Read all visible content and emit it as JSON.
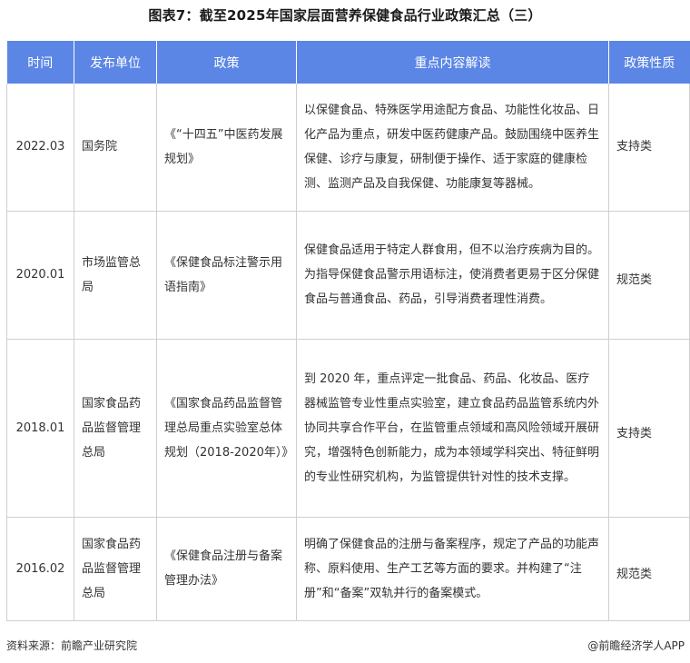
{
  "title": "图表7：截至2025年国家层面营养保健食品行业政策汇总（三）",
  "table": {
    "headers": [
      "时间",
      "发布单位",
      "政策",
      "重点内容解读",
      "政策性质"
    ],
    "rows": [
      {
        "time": "2022.03",
        "issuer": "国务院",
        "policy": "《“十四五”中医药发展规划》",
        "content": "以保健食品、特殊医学用途配方食品、功能性化妆品、日化产品为重点，研发中医药健康产品。鼓励围绕中医养生保健、诊疗与康复，研制便于操作、适于家庭的健康检测、监测产品及自我保健、功能康复等器械。",
        "nature": "支持类"
      },
      {
        "time": "2020.01",
        "issuer": "市场监管总局",
        "policy": "《保健食品标注警示用语指南》",
        "content": "保健食品适用于特定人群食用，但不以治疗疾病为目的。为指导保健食品警示用语标注，使消费者更易于区分保健食品与普通食品、药品，引导消费者理性消费。",
        "nature": "规范类"
      },
      {
        "time": "2018.01",
        "issuer": "国家食品药品监督管理总局",
        "policy": "《国家食品药品监督管理总局重点实验室总体规划（2018-2020年）》",
        "content": "到 2020 年，重点评定一批食品、药品、化妆品、医疗器械监管专业性重点实验室，建立食品药品监管系统内外协同共享合作平台，在监管重点领域和高风险领域开展研究，增强特色创新能力，成为本领域学科突出、特征鲜明的专业性研究机构，为监管提供针对性的技术支撑。",
        "nature": "支持类"
      },
      {
        "time": "2016.02",
        "issuer": "国家食品药品监督管理总局",
        "policy": "《保健食品注册与备案管理办法》",
        "content": "明确了保健食品的注册与备案程序，规定了产品的功能声称、原料使用、生产工艺等方面的要求。并构建了“注册”和“备案”双轨并行的备案模式。",
        "nature": "规范类"
      }
    ]
  },
  "footer": {
    "source": "资料来源：前瞻产业研究院",
    "credit": "@前瞻经济学人APP"
  },
  "colors": {
    "header_bg": "#5b86e5",
    "header_text": "#ffffff",
    "grid": "#cfcfcf"
  }
}
